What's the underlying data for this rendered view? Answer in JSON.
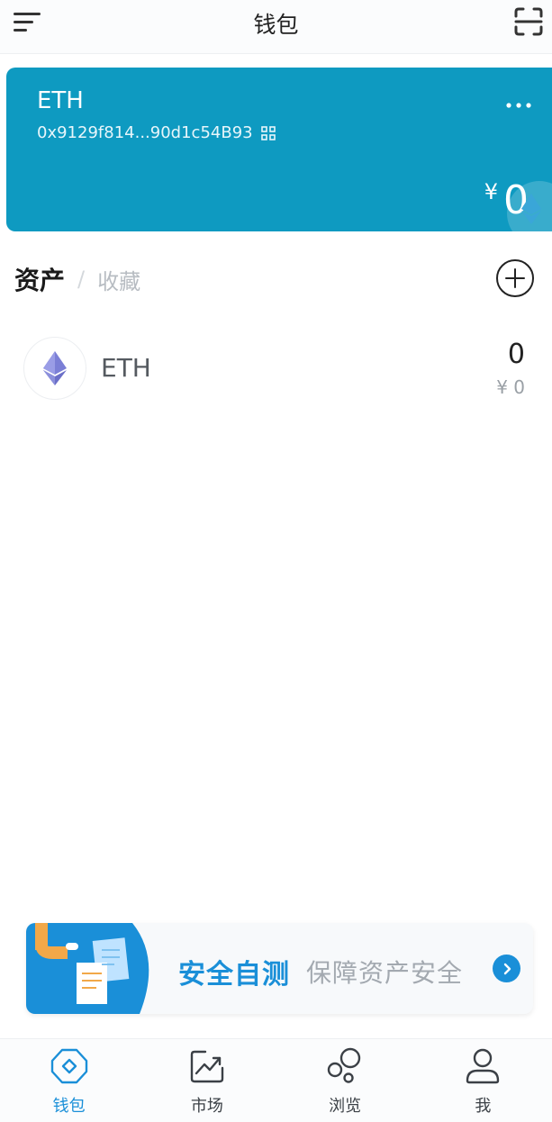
{
  "header": {
    "title": "钱包"
  },
  "wallet_card": {
    "chain": "ETH",
    "address": "0x9129f814...90d1c54B93",
    "currency_symbol": "¥",
    "balance": "0",
    "color": "#0e9ac1"
  },
  "assets": {
    "tabs": [
      {
        "label": "资产"
      },
      {
        "label": "收藏"
      }
    ],
    "separator": "/",
    "items": [
      {
        "name": "ETH",
        "quantity": "0",
        "value": "¥ 0"
      }
    ]
  },
  "security_banner": {
    "headline": "安全自测",
    "tagline": "保障资产安全"
  },
  "bottom_nav": {
    "items": [
      {
        "label": "钱包",
        "icon": "wallet-icon"
      },
      {
        "label": "市场",
        "icon": "market-chart-icon"
      },
      {
        "label": "浏览",
        "icon": "browse-bubbles-icon"
      },
      {
        "label": "我",
        "icon": "profile-icon"
      }
    ]
  },
  "colors": {
    "accent": "#1a8fd8",
    "text": "#222222",
    "muted": "#b7bcc2"
  }
}
